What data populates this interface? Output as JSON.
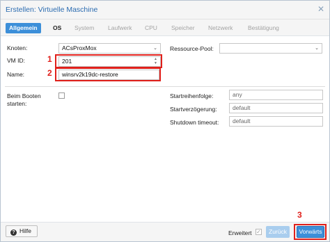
{
  "window": {
    "title": "Erstellen: Virtuelle Maschine"
  },
  "tabs": [
    {
      "label": "Allgemein"
    },
    {
      "label": "OS"
    },
    {
      "label": "System"
    },
    {
      "label": "Laufwerk"
    },
    {
      "label": "CPU"
    },
    {
      "label": "Speicher"
    },
    {
      "label": "Netzwerk"
    },
    {
      "label": "Bestätigung"
    }
  ],
  "form": {
    "node_label": "Knoten:",
    "node_value": "ACsProxMox",
    "vmid_label": "VM ID:",
    "vmid_value": "201",
    "name_label": "Name:",
    "name_value": "winsrv2k19dc-restore",
    "pool_label": "Ressource-Pool:",
    "pool_value": "",
    "onboot_label_1": "Beim Booten",
    "onboot_label_2": "starten:",
    "onboot_checked": false,
    "startorder_label": "Startreihenfolge:",
    "startorder_value": "any",
    "startdelay_label": "Startverzögerung:",
    "startdelay_value": "default",
    "shutdown_label": "Shutdown timeout:",
    "shutdown_value": "default"
  },
  "annotations": [
    {
      "number": "1"
    },
    {
      "number": "2"
    },
    {
      "number": "3"
    }
  ],
  "footer": {
    "help_label": "Hilfe",
    "advanced_label": "Erweitert",
    "advanced_checked": true,
    "back_label": "Zurück",
    "next_label": "Vorwärts"
  },
  "colors": {
    "accent": "#3c8fd9",
    "title": "#2a6bb0",
    "annotation": "#e0201b"
  }
}
